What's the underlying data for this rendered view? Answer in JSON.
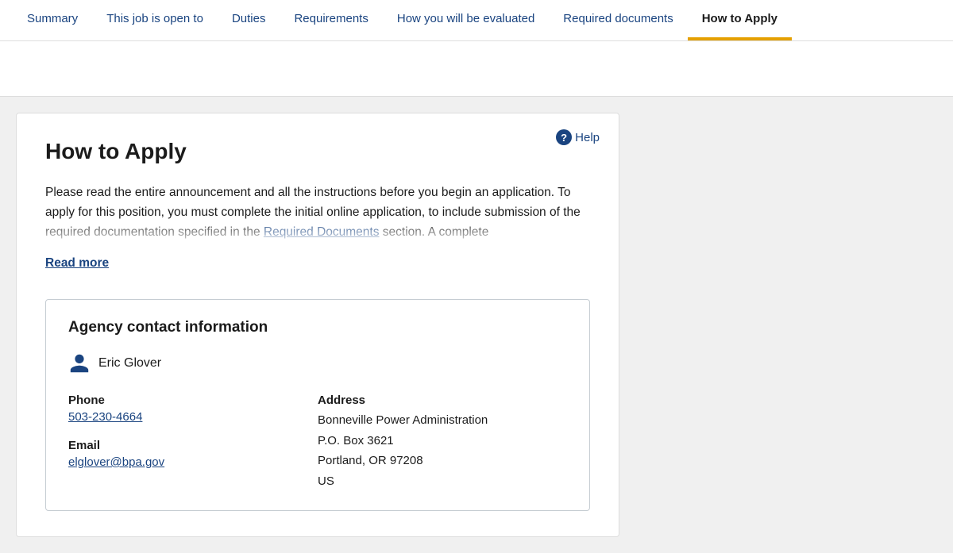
{
  "nav": {
    "items": [
      {
        "id": "summary",
        "label": "Summary",
        "active": false
      },
      {
        "id": "open-to",
        "label": "This job is open to",
        "active": false
      },
      {
        "id": "duties",
        "label": "Duties",
        "active": false
      },
      {
        "id": "requirements",
        "label": "Requirements",
        "active": false
      },
      {
        "id": "evaluation",
        "label": "How you will be evaluated",
        "active": false
      },
      {
        "id": "documents",
        "label": "Required documents",
        "active": false
      },
      {
        "id": "apply",
        "label": "How to Apply",
        "active": true
      }
    ]
  },
  "section": {
    "title": "How to Apply",
    "help_label": "Help",
    "body_text_start": "Please read the entire announcement and all the instructions before you begin an application. To apply for this position, you must complete the initial online application, to include submission of the required documentation specified in the ",
    "body_link": "Required Documents",
    "body_text_end": " section. A complete",
    "read_more": "Read more"
  },
  "agency": {
    "title": "Agency contact information",
    "contact_name": "Eric Glover",
    "phone_label": "Phone",
    "phone_value": "503-230-4664",
    "email_label": "Email",
    "email_value": "elglover@bpa.gov",
    "address_label": "Address",
    "address_line1": "Bonneville Power Administration",
    "address_line2": "P.O. Box 3621",
    "address_line3": "Portland, OR 97208",
    "address_line4": "US"
  }
}
